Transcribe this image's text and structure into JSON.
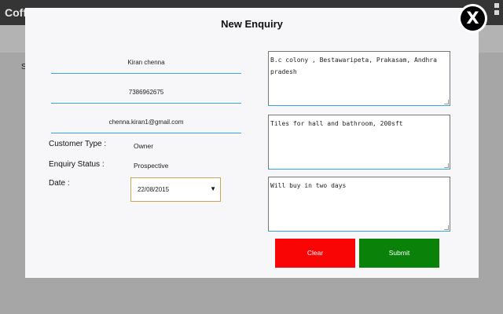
{
  "background": {
    "app_title": "Coff",
    "partial_text": "S"
  },
  "modal": {
    "title": "New Enquiry",
    "name": "Kiran chenna",
    "phone": "7386962675",
    "email": "chenna.kiran1@gmail.com",
    "customer_type_label": "Customer Type :",
    "customer_type_value": "Owner",
    "enquiry_status_label": "Enquiry Status :",
    "enquiry_status_value": "Prospective",
    "date_label": "Date :",
    "date_value": "22/08/2015",
    "address": "B.c colony , Bestawaripeta, Prakasam, Andhra pradesh",
    "requirement": "Tiles for hall and bathroom, 200sft",
    "remarks": "Will buy in two days",
    "clear_label": "Clear",
    "submit_label": "Submit",
    "close_label": "X"
  },
  "colors": {
    "clear_button": "#f90505",
    "submit_button": "#0a820a",
    "field_underline": "#39a6dc",
    "overlay": "#a6a6a6"
  }
}
